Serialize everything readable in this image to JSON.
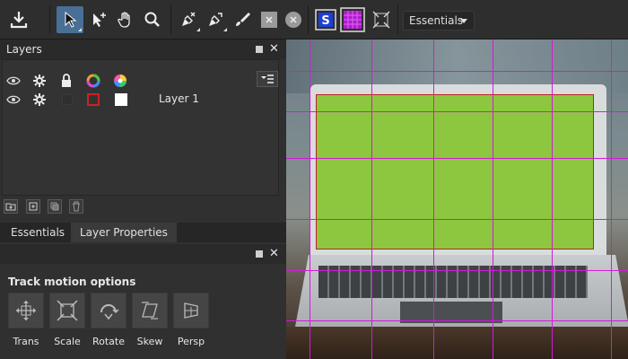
{
  "toolbar": {
    "tools": [
      {
        "icon": "export-icon"
      },
      {
        "icon": "select-arrow-icon"
      },
      {
        "icon": "add-point-icon"
      },
      {
        "icon": "hand-icon"
      },
      {
        "icon": "zoom-icon"
      },
      {
        "icon": "pen-remove-icon"
      },
      {
        "icon": "pen-convert-icon"
      },
      {
        "icon": "brush-icon"
      },
      {
        "icon": "x-square-icon"
      },
      {
        "icon": "x-circle-icon"
      },
      {
        "icon": "s-badge-icon"
      },
      {
        "icon": "grid-icon"
      },
      {
        "icon": "fit-icon"
      }
    ],
    "workspace_dropdown": "Essentials"
  },
  "layers_panel": {
    "title": "Layers",
    "header_icons": [
      "eye-icon",
      "gear-icon",
      "lock-icon",
      "color-ring-icon",
      "color-wheel-icon",
      "panel-menu-icon"
    ],
    "layers": [
      {
        "name": "Layer 1"
      }
    ],
    "footer_icons": [
      "new-folder-icon",
      "new-layer-icon",
      "duplicate-icon",
      "trash-icon"
    ]
  },
  "tabs": [
    {
      "label": "Essentials",
      "active": false
    },
    {
      "label": "Layer Properties",
      "active": true
    }
  ],
  "properties_panel": {
    "section_title": "Track motion options",
    "motion_options": [
      {
        "label": "Trans",
        "icon": "translate-icon"
      },
      {
        "label": "Scale",
        "icon": "scale-icon"
      },
      {
        "label": "Rotate",
        "icon": "rotate-icon"
      },
      {
        "label": "Skew",
        "icon": "skew-icon"
      },
      {
        "label": "Persp",
        "icon": "perspective-icon"
      }
    ]
  },
  "colors": {
    "accent": "#4a6f96",
    "grid": "#d21ad8",
    "screen_green": "#8dc63f",
    "layer_red": "#cc2222"
  }
}
